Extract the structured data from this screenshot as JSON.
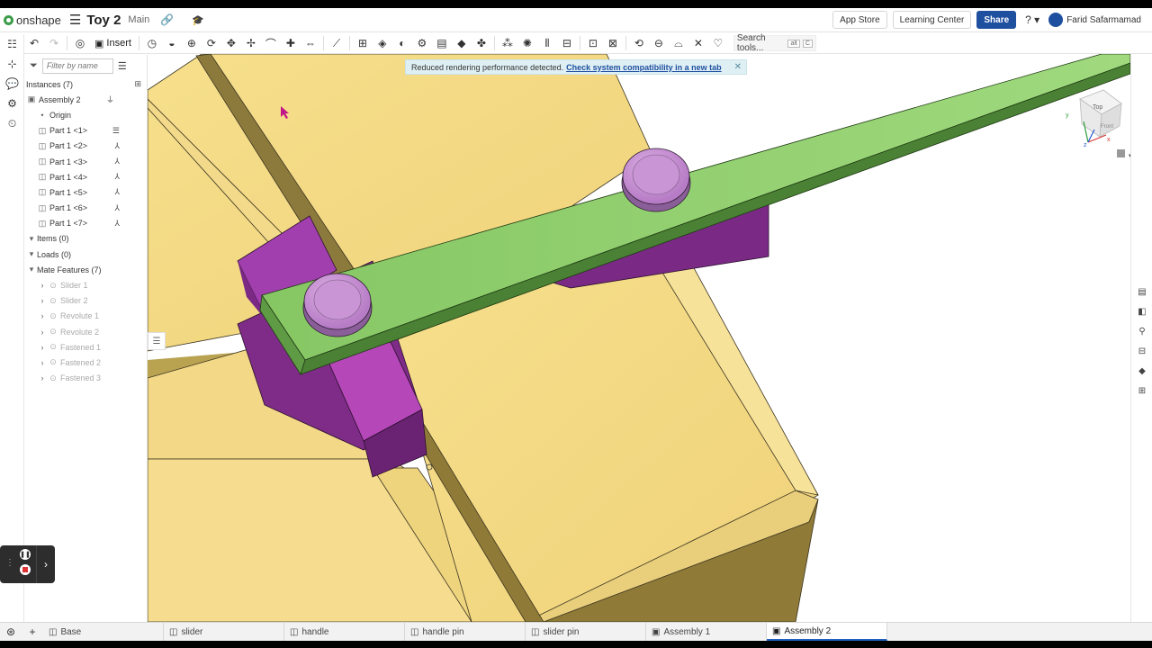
{
  "header": {
    "logo": "onshape",
    "doc_title": "Toy 2",
    "branch": "Main",
    "app_store": "App Store",
    "learning_center": "Learning Center",
    "share": "Share",
    "user_name": "Farid Safarmamad"
  },
  "toolbar": {
    "insert": "Insert",
    "search_placeholder": "Search tools...",
    "kbd1": "alt",
    "kbd2": "C"
  },
  "panel": {
    "filter_placeholder": "Filter by name",
    "instances_title": "Instances (7)",
    "assembly": "Assembly 2",
    "origin": "Origin",
    "parts": [
      "Part 1 <1>",
      "Part 1 <2>",
      "Part 1 <3>",
      "Part 1 <4>",
      "Part 1 <5>",
      "Part 1 <6>",
      "Part 1 <7>"
    ],
    "items": "Items (0)",
    "loads": "Loads (0)",
    "mate_features": "Mate Features (7)",
    "mates": [
      "Slider 1",
      "Slider 2",
      "Revolute 1",
      "Revolute 2",
      "Fastened 1",
      "Fastened 2",
      "Fastened 3"
    ]
  },
  "banner": {
    "message": "Reduced rendering performance detected.",
    "link": "Check system compatibility in a new tab"
  },
  "viewcube": {
    "top": "Top",
    "front": "Front",
    "axis_x": "x",
    "axis_y": "y",
    "axis_z": "z"
  },
  "tabs": [
    "Base",
    "slider",
    "handle",
    "handle pin",
    "slider pin",
    "Assembly 1",
    "Assembly 2"
  ],
  "colors": {
    "yellow_part": "#f3d97f",
    "purple_part": "#a540a8",
    "green_part": "#8fcf6e",
    "pin": "#c78ed2",
    "accent": "#1f4f9f"
  }
}
